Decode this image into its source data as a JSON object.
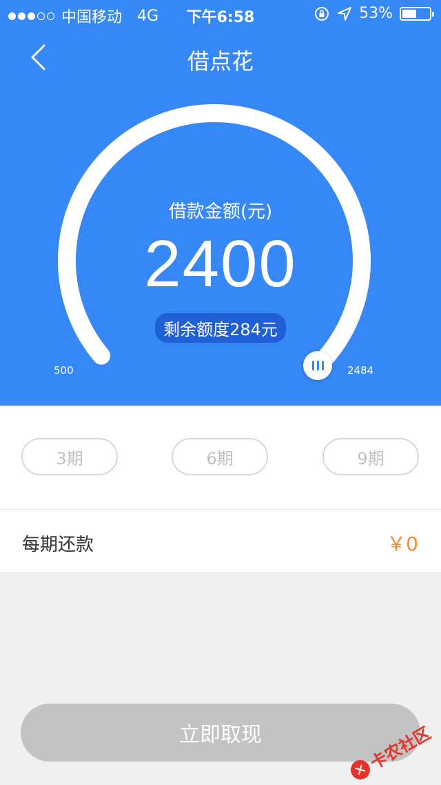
{
  "status_bar": {
    "carrier": "中国移动",
    "network": "4G",
    "time": "下午6:58",
    "battery_percent": "53%",
    "battery_level": 0.53,
    "signal_filled": 3,
    "signal_total": 5,
    "icons": [
      "orientation-lock-icon",
      "location-arrow-icon",
      "battery-icon"
    ]
  },
  "nav": {
    "title": "借点花",
    "back_icon": "chevron-left-icon"
  },
  "dial": {
    "label": "借款金额(元)",
    "amount": "2400",
    "remaining": "剩余额度284元",
    "min": "500",
    "max": "2484",
    "value_fraction": 0.96
  },
  "terms": [
    {
      "label": "3期"
    },
    {
      "label": "6期"
    },
    {
      "label": "9期"
    }
  ],
  "repayment": {
    "label": "每期还款",
    "value": "￥0"
  },
  "withdraw": {
    "label": "立即取现"
  },
  "watermark": {
    "mark": "✕",
    "text": "卡农社区"
  },
  "colors": {
    "primary_blue": "#3688f6",
    "pill_blue": "#1f5fd8",
    "accent_orange": "#f28b30",
    "disabled_gray": "#c3c3c3",
    "watermark_red": "#e8322b"
  }
}
